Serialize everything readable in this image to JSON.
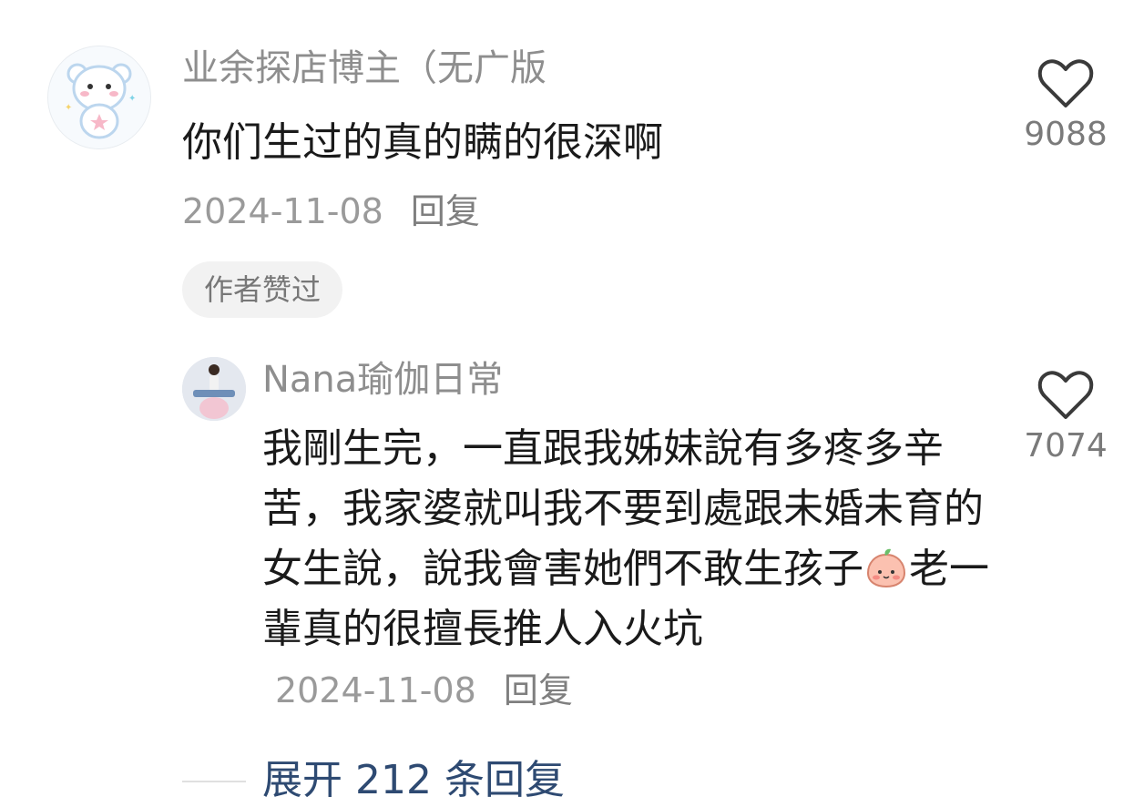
{
  "comment": {
    "username": "业余探店博主（无广版",
    "text": "你们生过的真的瞒的很深啊",
    "date": "2024-11-08",
    "reply_label": "回复",
    "badge": "作者赞过",
    "likes": "9088"
  },
  "reply": {
    "username": "Nana瑜伽日常",
    "text_before_emoji": "我剛生完，一直跟我姊妹說有多疼多辛苦，我家婆就叫我不要到處跟未婚未育的女生說，說我會害她們不敢生孩子",
    "text_after_emoji": "老一輩真的很擅長推人入火坑",
    "emoji": "peach-face-emoji",
    "date": "2024-11-08",
    "reply_label": "回复",
    "likes": "7074"
  },
  "expand_replies": "展开 212 条回复",
  "icons": {
    "like": "heart-outline-icon"
  },
  "colors": {
    "text": "#1a1a1a",
    "muted": "#8e8e8e",
    "link": "#2e4a72",
    "badge_bg": "#f2f2f2"
  }
}
